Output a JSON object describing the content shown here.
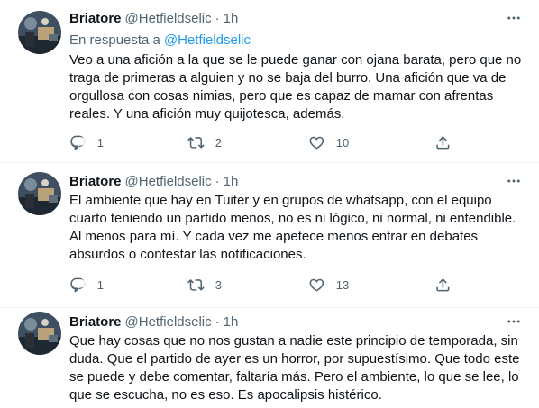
{
  "tweets": [
    {
      "name": "Briatore",
      "handle": "@Hetfieldselic",
      "separator": "·",
      "time": "1h",
      "reply_prefix": "En respuesta a",
      "reply_handle": "@Hetfieldselic",
      "text": "Veo a una afición a la que se le puede ganar con ojana barata, pero que no traga de primeras a alguien y no se baja del burro. Una afición que va de orgullosa con cosas nimias, pero que es capaz de mamar con afrentas reales. Y una afición muy quijotesca, además.",
      "replies": "1",
      "retweets": "2",
      "likes": "10"
    },
    {
      "name": "Briatore",
      "handle": "@Hetfieldselic",
      "separator": "·",
      "time": "1h",
      "text": "El ambiente que hay en Tuiter y en grupos de whatsapp, con el equipo cuarto teniendo un partido menos, no es ni lógico, ni normal, ni entendible. Al menos para mí. Y cada vez me apetece menos entrar en debates absurdos o contestar las notificaciones.",
      "replies": "1",
      "retweets": "3",
      "likes": "13"
    },
    {
      "name": "Briatore",
      "handle": "@Hetfieldselic",
      "separator": "·",
      "time": "1h",
      "text": "Que hay cosas que no nos gustan a nadie este principio de temporada, sin duda. Que el partido de ayer es un horror, por supuestísimo. Que todo este se puede y debe comentar, faltaría más. Pero el ambiente, lo que se lee, lo que se escucha, no es eso. Es apocalipsis histérico."
    }
  ],
  "icons": {
    "reply": "reply-icon",
    "retweet": "retweet-icon",
    "like": "heart-icon",
    "share": "share-icon",
    "more": "more-icon"
  },
  "colors": {
    "text": "#0f1419",
    "secondary": "#536471",
    "link": "#1d9bf0",
    "border": "#eff3f4"
  }
}
